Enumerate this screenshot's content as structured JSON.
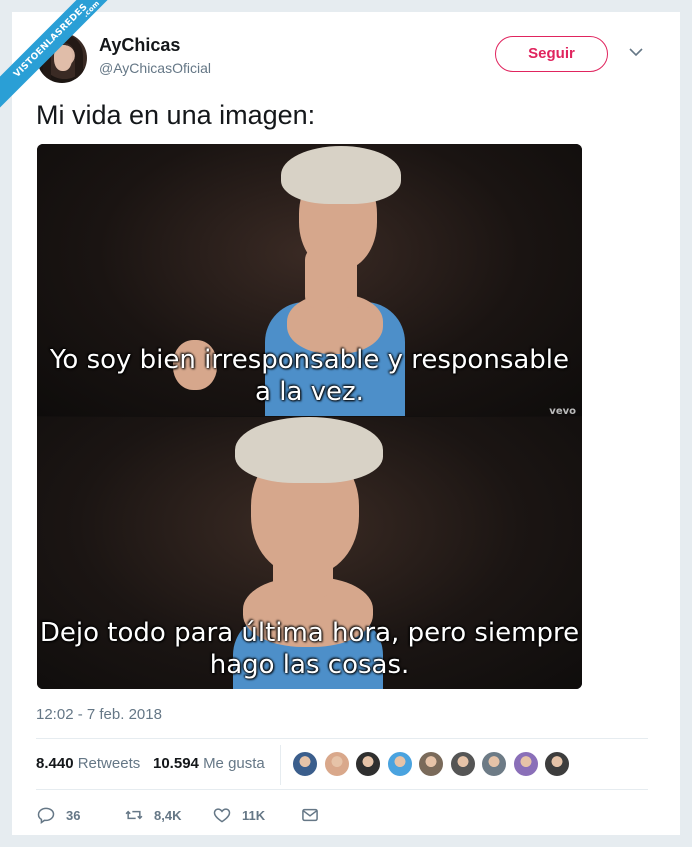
{
  "watermark": {
    "label": "VISTOENLASREDES",
    "suffix": ".com"
  },
  "author": {
    "name": "AyChicas",
    "handle": "@AyChicasOficial"
  },
  "follow": {
    "label": "Seguir"
  },
  "tweet": {
    "text": "Mi vida en una imagen:"
  },
  "media": {
    "captions": [
      "Yo soy bien irresponsable y responsable a la vez.",
      "Dejo todo para última hora, pero siempre hago las cosas."
    ],
    "watermark": "vevo"
  },
  "timestamp": "12:02 - 7 feb. 2018",
  "stats": {
    "retweets_count": "8.440",
    "retweets_label": "Retweets",
    "likes_count": "10.594",
    "likes_label": "Me gusta"
  },
  "actions": {
    "replies": "36",
    "retweets": "8,4K",
    "likes": "11K"
  },
  "colors": {
    "accent": "#e0245e",
    "muted": "#657786",
    "text": "#14171a"
  },
  "likers": [
    "#3b5e8c",
    "#d9a88b",
    "#2f2f2f",
    "#4aa3df",
    "#7a6a5a",
    "#555555",
    "#6d7b86",
    "#8a6fb8",
    "#3d3d3d"
  ]
}
